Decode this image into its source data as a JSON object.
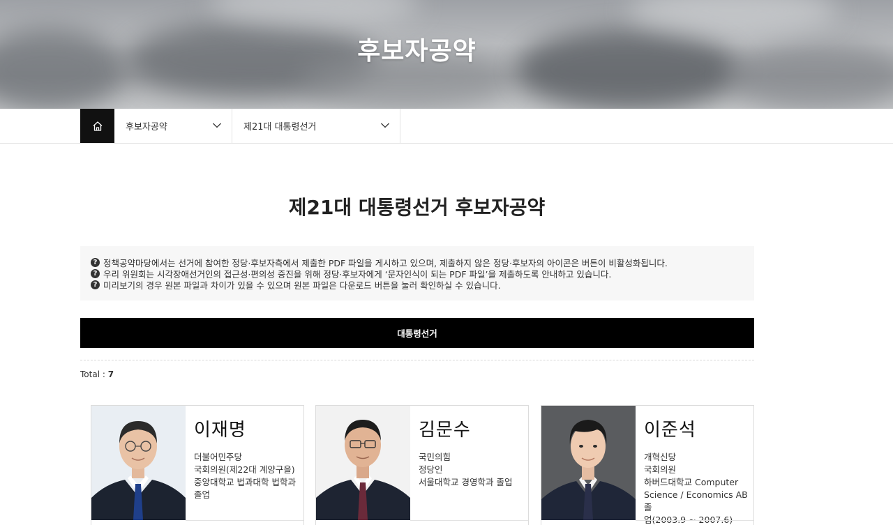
{
  "hero": {
    "title": "후보자공약"
  },
  "nav": {
    "home_label": "",
    "dropdown1": "후보자공약",
    "dropdown2": "제21대 대통령선거"
  },
  "page_title": "제21대 대통령선거 후보자공약",
  "notice": [
    "정책공약마당에서는 선거에 참여한 정당·후보자측에서 제출한 PDF 파일을 게시하고 있으며, 제출하지 않은 정당·후보자의 아이콘은 버튼이 비활성화됩니다.",
    "우리 위원회는 시각장애선거인의 접근성·편의성 증진을 위해 정당·후보자에게 ‘문자인식이 되는 PDF 파일’을 제출하도록 안내하고 있습니다.",
    "미리보기의 경우 원본 파일과 차이가 있을 수 있으며 원본 파일은 다운로드 버튼을 눌러 확인하실 수 있습니다."
  ],
  "notice_icon": "question-circle-icon",
  "tab": {
    "label": "대통령선거"
  },
  "total": {
    "label": "Total : ",
    "count": "7"
  },
  "candidates": [
    {
      "name": "이재명",
      "lines": [
        "더불어민주당",
        "국회의원(제22대 계양구을)",
        "중앙대학교 법과대학 법학과",
        "졸업"
      ],
      "tie_color": "#1f3f8a",
      "suit_color": "#1c2330",
      "bg_color": "#e9eef3"
    },
    {
      "name": "김문수",
      "lines": [
        "국민의힘",
        "정당인",
        "서울대학교 경영학과 졸업"
      ],
      "tie_color": "#6b2a3a",
      "suit_color": "#1e2432",
      "bg_color": "#f2f2f2"
    },
    {
      "name": "이준석",
      "lines": [
        "개혁신당",
        "국회의원",
        "하버드대학교 Computer",
        "Science / Economics AB 졸",
        "업(2003.9 ~ 2007.6)"
      ],
      "tie_color": "#2a2f4a",
      "suit_color": "#1f2638",
      "bg_color": "#5a5c5f"
    }
  ]
}
